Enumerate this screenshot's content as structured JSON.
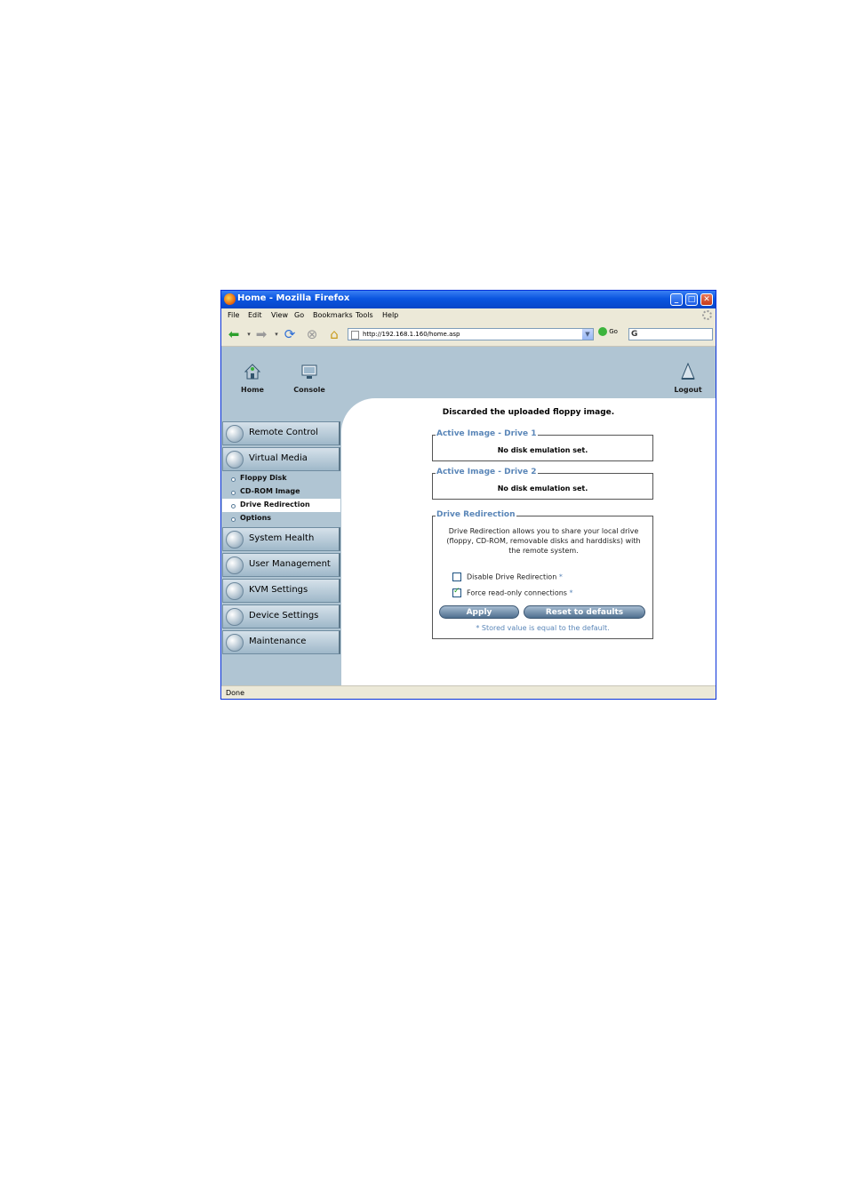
{
  "window": {
    "title": "Home - Mozilla Firefox"
  },
  "menu": [
    "File",
    "Edit",
    "View",
    "Go",
    "Bookmarks",
    "Tools",
    "Help"
  ],
  "toolbar": {
    "url": "http://192.168.1.160/home.asp",
    "go_label": "Go"
  },
  "header": {
    "home_label": "Home",
    "console_label": "Console",
    "logout_label": "Logout"
  },
  "sidebar": {
    "items": [
      {
        "label": "Remote Control"
      },
      {
        "label": "Virtual Media"
      },
      {
        "label": "System Health"
      },
      {
        "label": "User Management"
      },
      {
        "label": "KVM Settings"
      },
      {
        "label": "Device Settings"
      },
      {
        "label": "Maintenance"
      }
    ],
    "subitems": [
      {
        "label": "Floppy Disk"
      },
      {
        "label": "CD-ROM Image"
      },
      {
        "label": "Drive Redirection"
      },
      {
        "label": "Options"
      }
    ]
  },
  "main": {
    "message": "Discarded the uploaded floppy image.",
    "drive1": {
      "legend": "Active Image - Drive 1",
      "value": "No disk emulation set."
    },
    "drive2": {
      "legend": "Active Image - Drive 2",
      "value": "No disk emulation set."
    },
    "redirection": {
      "legend": "Drive Redirection",
      "description": "Drive Redirection allows you to share your local drive (floppy, CD-ROM, removable disks and harddisks) with the remote system.",
      "disable_label": "Disable Drive Redirection",
      "disable_checked": false,
      "readonly_label": "Force read-only connections",
      "readonly_checked": true,
      "star": "*",
      "apply_label": "Apply",
      "reset_label": "Reset to defaults",
      "note": "* Stored value is equal to the default."
    }
  },
  "status": {
    "text": "Done"
  }
}
